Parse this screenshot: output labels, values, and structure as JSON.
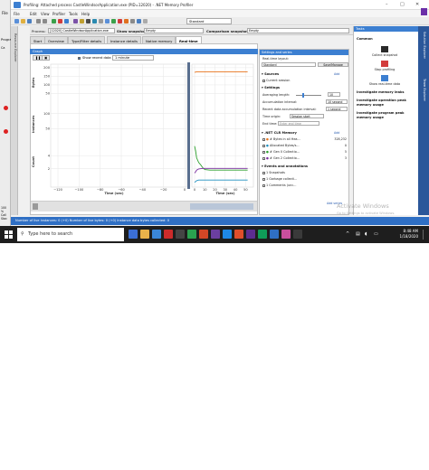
{
  "window": {
    "title": "Profiling: Attached process CastleWindsorApplication.exe (PID=12020) - .NET Memory Profiler",
    "controls": [
      "–",
      "□",
      "✕"
    ]
  },
  "menu": [
    "File",
    "Edit",
    "View",
    "Profiler",
    "Tools",
    "Help"
  ],
  "toolbar": {
    "layout_select": "Standard"
  },
  "outer_left": {
    "file_label": "File",
    "progra_label": "Progra",
    "item_label": "Ca",
    "zoom": "100 %",
    "callstack": "Call Stac"
  },
  "process_bar": {
    "process_label": "Process:",
    "process_value": "[12020] CastleWindsorApplication.exe",
    "show_label": "Show snapshot:",
    "show_value": "Empty",
    "compare_label": "Comparison snapshot:",
    "compare_value": "Empty"
  },
  "tabs": [
    "Start",
    "Overview",
    "Type/Filter details",
    "Instance details",
    "Native memory",
    "Real-time"
  ],
  "active_tab": 5,
  "graph_panel": {
    "header": "Graph",
    "show_recent_label": "Show recent data",
    "interval_value": "1 minute",
    "recent_checked": true
  },
  "chart_data": {
    "type": "line",
    "xlabel": "Time (sec)",
    "left_x_ticks": [
      "−120",
      "−100",
      "−80",
      "−60",
      "−40",
      "−20",
      "0"
    ],
    "right_x_ticks": [
      "0",
      "10",
      "20",
      "30",
      "40",
      "50"
    ],
    "bytes_label": "Bytes",
    "bytes_ticks": [
      "200",
      "150",
      "100",
      "50"
    ],
    "instances_label": "Instances",
    "instances_ticks": [
      "100",
      "50"
    ],
    "count_label": "Count",
    "count_ticks": [
      "4",
      "2"
    ],
    "series": [
      {
        "color": "#e8741c",
        "x": [
          0,
          2,
          10,
          20,
          30,
          40,
          52
        ],
        "y": [
          196,
          197,
          197,
          197,
          197,
          197,
          197
        ]
      },
      {
        "color": "#2ca02c",
        "x": [
          0,
          1,
          2,
          4,
          6,
          8,
          10,
          15,
          20,
          30,
          40,
          52
        ],
        "y": [
          70,
          62,
          50,
          42,
          38,
          33,
          30,
          29,
          29,
          29,
          29,
          29
        ]
      },
      {
        "color": "#7b2ea0",
        "x": [
          0,
          1,
          2,
          4,
          8,
          20,
          30,
          40,
          52
        ],
        "y": [
          24,
          26,
          29,
          31,
          32,
          32,
          32,
          32,
          32
        ]
      },
      {
        "color": "#1f8fbf",
        "x": [
          0,
          2,
          4,
          10,
          20,
          30,
          40,
          52
        ],
        "y": [
          8,
          11,
          12,
          12,
          12,
          12,
          12,
          12
        ]
      }
    ]
  },
  "settings": {
    "header": "Settings and series",
    "layout_label": "Real-time layout:",
    "layout_value": "Standard",
    "save_button": "Save/Manage",
    "sources_title": "Sources",
    "add_link": "Add",
    "current_session": "Current session",
    "settings_title": "Settings",
    "averaging_label": "Averaging length:",
    "averaging_value": "10",
    "accum_label": "Accumulation interval:",
    "accum_value": "10 second",
    "recent_accum_label": "Recent data accumulation interval:",
    "recent_accum_value": "1 second",
    "time_origin_label": "Time origin:",
    "time_origin_value": "Session start",
    "end_time_label": "End time:",
    "end_time_value": "Enter end time",
    "clr_title": ".NET CLR Memory",
    "clr_items": [
      {
        "label": "# Bytes in all Hea...",
        "value": "328,232"
      },
      {
        "label": "Allocated Bytes/s...",
        "value": "0"
      },
      {
        "label": "# Gen 0 Collectio...",
        "value": "5"
      },
      {
        "label": "# Gen 2 Collectio...",
        "value": "3"
      }
    ],
    "events_title": "Events and annotations",
    "events": [
      {
        "label": "Snapshots",
        "value": "1"
      },
      {
        "label": "Garbage collecti...",
        "value": "1"
      },
      {
        "label": "Comments (unc...",
        "value": "1"
      }
    ],
    "add_series": "Add series"
  },
  "tasks": {
    "header": "Tasks",
    "common": "Common",
    "collect_snapshot": "Collect snapshot",
    "stop_profiling": "Stop profiling",
    "show_realtime": "Show real-time data",
    "leaks": "Investigate memory leaks",
    "peak_memory": "Investigate operation peak memory usage",
    "program_peak": "Investigate program peak memory usage"
  },
  "right_strip": [
    "Solution Explorer",
    "Team Explorer"
  ],
  "left_strip": "Resource Explorer",
  "status": "Number of live instances: 0 (+0)   Number of live bytes: 0 (+0)   Instance data bytes collected: 0",
  "watermark": {
    "line1": "Activate Windows",
    "line2": "Go to Settings to activate Windows."
  },
  "taskbar": {
    "search_placeholder": "Type here to search",
    "time": "8:48 AM",
    "date": "1/18/2020",
    "apps": [
      "#3b6fd6",
      "#e8b24a",
      "#3a86d8",
      "#cc2b2b",
      "#444444",
      "#2aa24f",
      "#d24726",
      "#6b3fa0",
      "#1e88e5",
      "#e04e2a",
      "#5c2d91",
      "#0f9d58",
      "#2f6fc4",
      "#c94f9d",
      "#3a3a3a"
    ]
  }
}
